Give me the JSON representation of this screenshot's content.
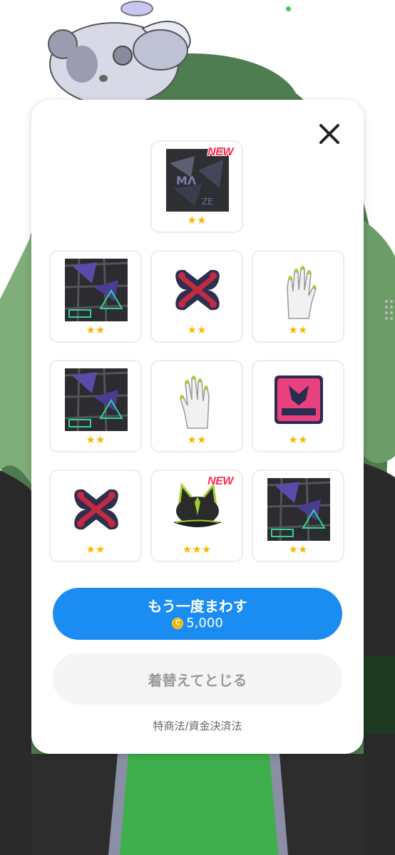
{
  "modal": {
    "close_icon": "close-icon",
    "items": [
      {
        "name": "item-pattern-dark",
        "stars": "★★",
        "new": "NEW"
      },
      {
        "name": "item-pattern-graffiti",
        "stars": "★★",
        "new": ""
      },
      {
        "name": "item-bone-patch",
        "stars": "★★",
        "new": ""
      },
      {
        "name": "item-white-glove",
        "stars": "★★",
        "new": ""
      },
      {
        "name": "item-pattern-graffiti",
        "stars": "★★",
        "new": ""
      },
      {
        "name": "item-white-glove",
        "stars": "★★",
        "new": ""
      },
      {
        "name": "item-pink-wolf-badge",
        "stars": "★★",
        "new": ""
      },
      {
        "name": "item-bone-patch",
        "stars": "★★",
        "new": ""
      },
      {
        "name": "item-cat-ear-cap",
        "stars": "★★★",
        "new": "NEW"
      },
      {
        "name": "item-pattern-graffiti",
        "stars": "★★",
        "new": ""
      }
    ],
    "spin_again": {
      "label": "もう一度まわす",
      "coin_symbol": "C",
      "cost": "5,000"
    },
    "dress_close": {
      "label": "着替えてとじる"
    },
    "legal_link": "特商法/資金決済法"
  },
  "colors": {
    "primary_button": "#1a8cf2",
    "star": "#f5b800",
    "new_badge": "#ff2d55",
    "coin": "#f7b500"
  }
}
